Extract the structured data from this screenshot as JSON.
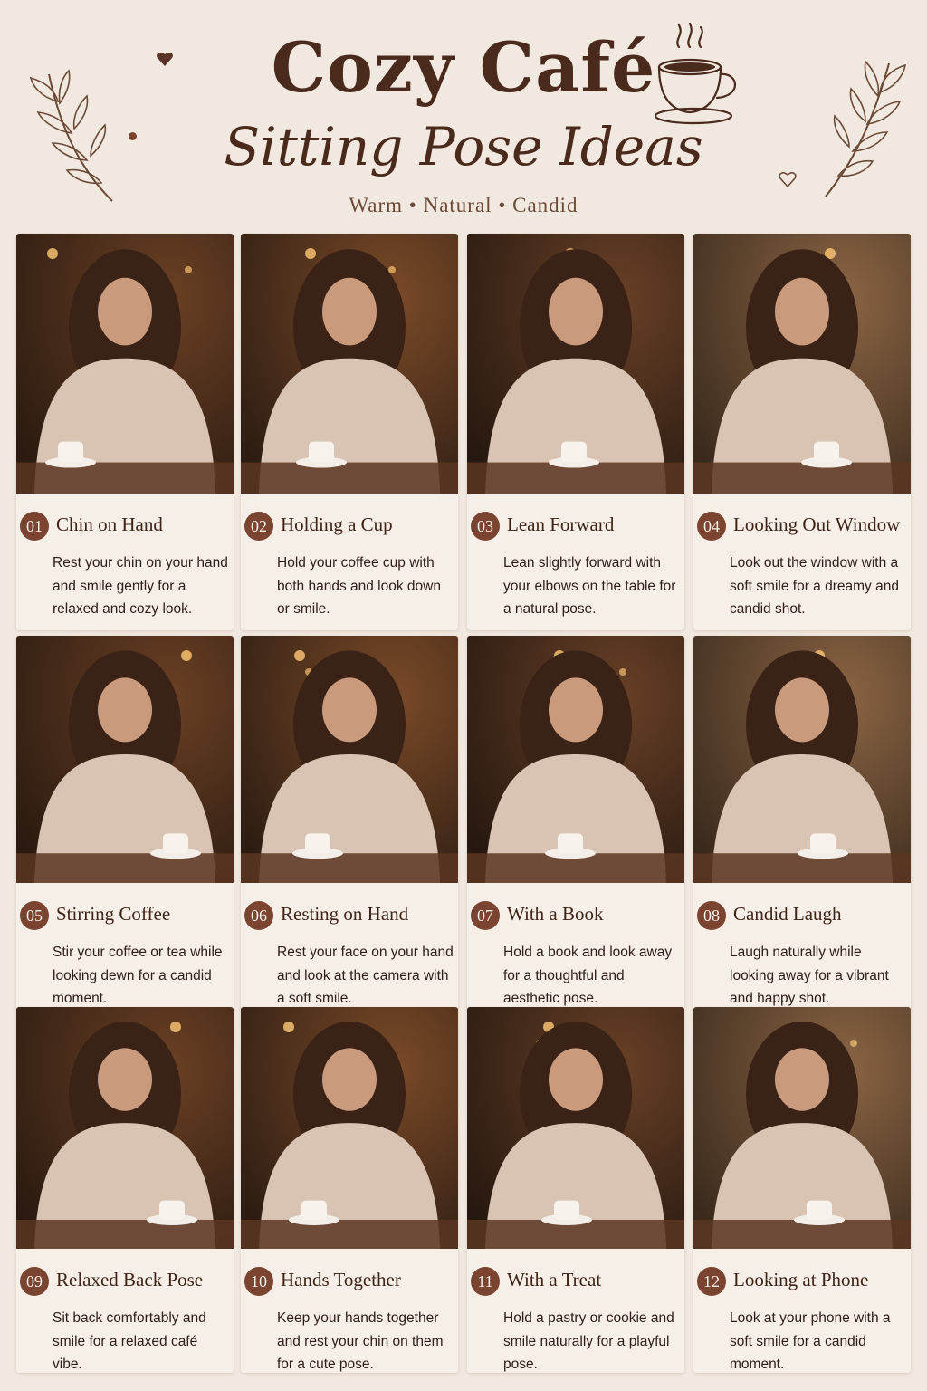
{
  "header": {
    "title": "Cozy Café",
    "subtitle": "Sitting Pose Ideas",
    "tagline": "Warm • Natural • Candid"
  },
  "colors": {
    "background": "#f1e8df",
    "accent": "#7a4430",
    "text": "#4a2a1c",
    "sweater": "#d9c4b4",
    "hair": "#3a2216"
  },
  "icons": [
    "coffee-cup-icon",
    "leaf-branch-icon",
    "heart-icon"
  ],
  "poses": [
    {
      "num": "01",
      "title": "Chin on Hand",
      "desc": "Rest your chin on your hand and smile gently for a relaxed and cozy look."
    },
    {
      "num": "02",
      "title": "Holding a Cup",
      "desc": "Hold your coffee cup with both hands and look down or smile."
    },
    {
      "num": "03",
      "title": "Lean Forward",
      "desc": "Lean slightly forward with your elbows on the table for a natural pose."
    },
    {
      "num": "04",
      "title": "Looking Out Window",
      "desc": "Look out the window with a soft smile for a dreamy and candid shot."
    },
    {
      "num": "05",
      "title": "Stirring Coffee",
      "desc": "Stir your coffee or tea while looking dewn for a candid moment."
    },
    {
      "num": "06",
      "title": "Resting on Hand",
      "desc": "Rest your face on your hand and look at the camera with a soft smile."
    },
    {
      "num": "07",
      "title": "With a Book",
      "desc": "Hold a book and look away for a thoughtful and aesthetic pose."
    },
    {
      "num": "08",
      "title": "Candid Laugh",
      "desc": "Laugh naturally while looking away for a vibrant and happy shot."
    },
    {
      "num": "09",
      "title": "Relaxed Back Pose",
      "desc": "Sit back comfortably and smile for a relaxed café vibe."
    },
    {
      "num": "10",
      "title": "Hands Together",
      "desc": "Keep your hands together and rest your chin on them for a cute pose."
    },
    {
      "num": "11",
      "title": "With a Treat",
      "desc": "Hold a pastry or cookie and smile naturally for a playful pose."
    },
    {
      "num": "12",
      "title": "Looking at Phone",
      "desc": "Look at your phone with a soft smile for a candid moment."
    }
  ]
}
